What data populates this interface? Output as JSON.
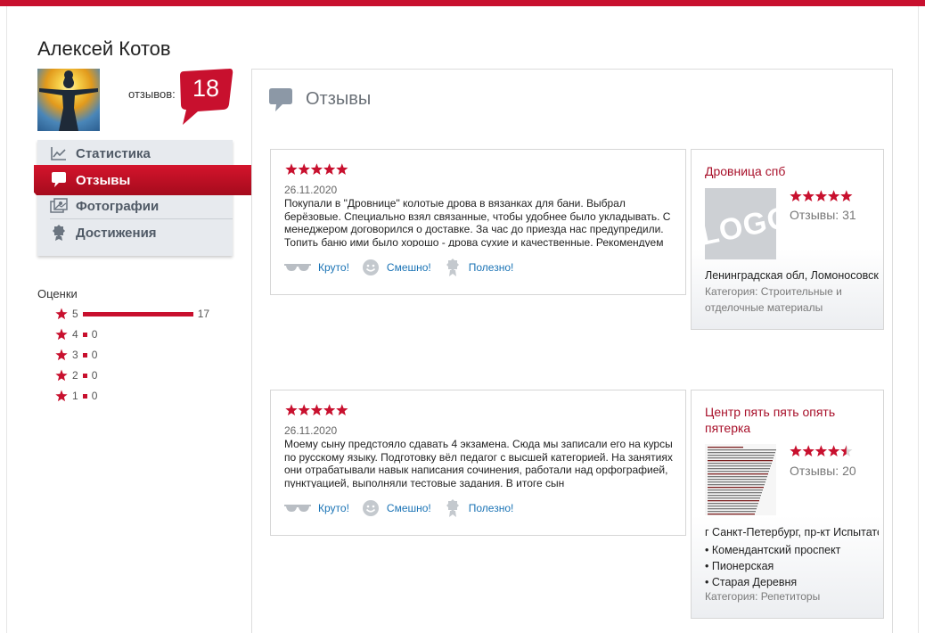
{
  "user": {
    "name": "Алексей Котов",
    "reviews_label": "отзывов:",
    "reviews_count": "18"
  },
  "nav": {
    "items": [
      {
        "label": "Статистика",
        "icon": "chart-line-icon"
      },
      {
        "label": "Отзывы",
        "icon": "speech-bubble-icon",
        "active": true
      },
      {
        "label": "Фотографии",
        "icon": "photos-icon"
      },
      {
        "label": "Достижения",
        "icon": "award-icon"
      }
    ]
  },
  "ratings": {
    "title": "Оценки",
    "rows": [
      {
        "stars": "5",
        "count": "17",
        "share": 1.0
      },
      {
        "stars": "4",
        "count": "0",
        "share": 0
      },
      {
        "stars": "3",
        "count": "0",
        "share": 0
      },
      {
        "stars": "2",
        "count": "0",
        "share": 0
      },
      {
        "stars": "1",
        "count": "0",
        "share": 0
      }
    ]
  },
  "main": {
    "title": "Отзывы"
  },
  "reviews": [
    {
      "rating": 5,
      "date": "26.11.2020",
      "text": "Покупали в \"Дровнице\" колотые дрова в вязанках для бани. Выбрал берёзовые. Специально взял связанные, чтобы удобнее было укладывать. С менеджером договорился о доставке. За час до приезда нас предупредили. Топить баню ими было хорошо - дрова сухие и качественные. Рекомендуем",
      "actions": {
        "cool": "Круто!",
        "funny": "Смешно!",
        "useful": "Полезно!"
      },
      "company": {
        "name": "Дровница спб",
        "rating": 5,
        "reviews": "Отзывы: 31",
        "logo_text": "LOGO",
        "address": "Ленинградская обл, Ломоносовский район",
        "metro": [],
        "category": "Категория: Строительные и отделочные материалы"
      }
    },
    {
      "rating": 5,
      "date": "26.11.2020",
      "text": "Моему сыну предстояло сдавать 4 экзамена. Сюда мы записали его на курсы по русскому языку. Подготовку вёл педагог с высшей категорией. На занятиях они отрабатывали навык написания сочинения, работали над орфографией, пунктуацией, выполняли тестовые задания. В итоге сын",
      "actions": {
        "cool": "Круто!",
        "funny": "Смешно!",
        "useful": "Полезно!"
      },
      "company": {
        "name": "Центр пять пять опять пятерка",
        "rating": 4.5,
        "reviews": "Отзывы: 20",
        "address": "г Санкт-Петербург, пр-кт Испытателей",
        "metro": [
          "• Комендантский проспект",
          "• Пионерская",
          "• Старая Деревня"
        ],
        "category": "Категория: Репетиторы"
      }
    }
  ],
  "colors": {
    "accent": "#c8102e",
    "link": "#1a73b5",
    "company_link": "#a8102a",
    "nav_bg": "#e7eaee"
  }
}
